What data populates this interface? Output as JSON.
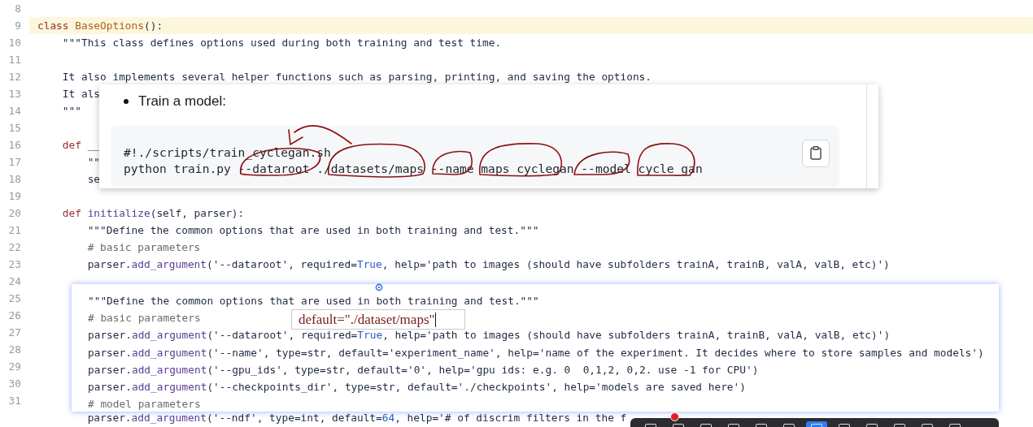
{
  "editor": {
    "lines": [
      {
        "number": "8",
        "current": false
      },
      {
        "number": "9",
        "current": true,
        "code": [
          {
            "kind": "kw",
            "text": "class "
          },
          {
            "kind": "cls",
            "text": "BaseOptions"
          },
          {
            "kind": "plain",
            "text": "():"
          }
        ]
      },
      {
        "number": "10",
        "current": false,
        "code": [
          {
            "kind": "plain",
            "text": "    \"\"\"This class defines options used during both training and test time."
          }
        ]
      },
      {
        "number": "11",
        "current": false
      },
      {
        "number": "12",
        "current": false,
        "code": [
          {
            "kind": "plain",
            "text": "    It also implements several helper functions such as parsing, printing, and saving the options."
          }
        ]
      },
      {
        "number": "13",
        "current": false,
        "code": [
          {
            "kind": "plain",
            "text": "    It als"
          }
        ]
      },
      {
        "number": "14",
        "current": false,
        "code": [
          {
            "kind": "plain",
            "text": "    \"\"\""
          }
        ]
      },
      {
        "number": "15",
        "current": false
      },
      {
        "number": "16",
        "current": false,
        "code": [
          {
            "kind": "kw",
            "text": "    def"
          },
          {
            "kind": "plain",
            "text": " __"
          }
        ]
      },
      {
        "number": "17",
        "current": false,
        "code": [
          {
            "kind": "plain",
            "text": "        \"\""
          }
        ]
      },
      {
        "number": "18",
        "current": false,
        "code": [
          {
            "kind": "plain",
            "text": "        se"
          }
        ]
      },
      {
        "number": "19",
        "current": false
      },
      {
        "number": "20",
        "current": false,
        "code": [
          {
            "kind": "kw",
            "text": "    def "
          },
          {
            "kind": "fn",
            "text": "initialize"
          },
          {
            "kind": "plain",
            "text": "(self, parser):"
          }
        ]
      },
      {
        "number": "21",
        "current": false,
        "code": [
          {
            "kind": "plain",
            "text": "        \"\"\"Define the common options that are used in both training and test.\"\"\""
          }
        ]
      },
      {
        "number": "22",
        "current": false,
        "code": [
          {
            "kind": "cmt",
            "text": "        # basic parameters"
          }
        ]
      },
      {
        "number": "23",
        "current": false,
        "code": [
          {
            "kind": "plain",
            "text": "        parser."
          },
          {
            "kind": "fn",
            "text": "add_argument"
          },
          {
            "kind": "plain",
            "text": "('--dataroot', required="
          },
          {
            "kind": "bool",
            "text": "True"
          },
          {
            "kind": "plain",
            "text": ", help='path to images (should have subfolders trainA, trainB, valA, valB, etc)')"
          }
        ]
      },
      {
        "number": "24",
        "current": false
      },
      {
        "number": "25",
        "current": false
      },
      {
        "number": "26",
        "current": false
      },
      {
        "number": "27",
        "current": false
      },
      {
        "number": "28",
        "current": false
      },
      {
        "number": "29",
        "current": false
      },
      {
        "number": "30",
        "current": false
      },
      {
        "number": "31",
        "current": false
      },
      {
        "current": false,
        "code": [
          {
            "kind": "plain",
            "text": "        parser."
          },
          {
            "kind": "fn",
            "text": "add_argument"
          },
          {
            "kind": "plain",
            "text": "('--ndf', type=int, default="
          },
          {
            "kind": "bool",
            "text": "64"
          },
          {
            "kind": "plain",
            "text": ", help='# of discrim filters in the f"
          }
        ]
      }
    ]
  },
  "readme_popup": {
    "bullet": "Train a model:",
    "code_lines": [
      "#!./scripts/train_cyclegan.sh",
      "python train.py --dataroot ./datasets/maps --name maps_cyclegan --model cycle_gan"
    ]
  },
  "code_popup": {
    "lines": [
      [
        {
          "kind": "plain",
          "text": "\"\"\"Define the common options that are used in both training and test.\"\"\""
        }
      ],
      [
        {
          "kind": "cmt",
          "text": "# basic parameters"
        }
      ],
      [
        {
          "kind": "plain",
          "text": "parser."
        },
        {
          "kind": "fn",
          "text": "add_argument"
        },
        {
          "kind": "plain",
          "text": "('--dataroot', required="
        },
        {
          "kind": "bool",
          "text": "True"
        },
        {
          "kind": "plain",
          "text": ", help='path to images (should have subfolders trainA, trainB, valA, valB, etc)')"
        }
      ],
      [
        {
          "kind": "plain",
          "text": "parser."
        },
        {
          "kind": "fn",
          "text": "add_argument"
        },
        {
          "kind": "plain",
          "text": "('--name', type=str, default='experiment_name', help='name of the experiment. It decides where to store samples and models')"
        }
      ],
      [
        {
          "kind": "plain",
          "text": "parser."
        },
        {
          "kind": "fn",
          "text": "add_argument"
        },
        {
          "kind": "plain",
          "text": "('--gpu_ids', type=str, default='0', help='gpu ids: e.g. 0  0,1,2, 0,2. use -1 for CPU')"
        }
      ],
      [
        {
          "kind": "plain",
          "text": "parser."
        },
        {
          "kind": "fn",
          "text": "add_argument"
        },
        {
          "kind": "plain",
          "text": "('--checkpoints_dir', type=str, default='./checkpoints', help='models are saved here')"
        }
      ],
      [
        {
          "kind": "cmt",
          "text": "# model parameters"
        }
      ]
    ]
  },
  "annotation_field": {
    "value": "default=\"./dataset/maps\""
  },
  "toolbar": {
    "tools": [
      {
        "selected": false
      },
      {
        "selected": false
      },
      {
        "selected": false
      },
      {
        "selected": false
      },
      {
        "selected": false
      },
      {
        "selected": false
      },
      {
        "selected": true
      },
      {
        "selected": false
      },
      {
        "selected": false
      },
      {
        "selected": false
      },
      {
        "selected": false
      },
      {
        "selected": false
      }
    ]
  }
}
